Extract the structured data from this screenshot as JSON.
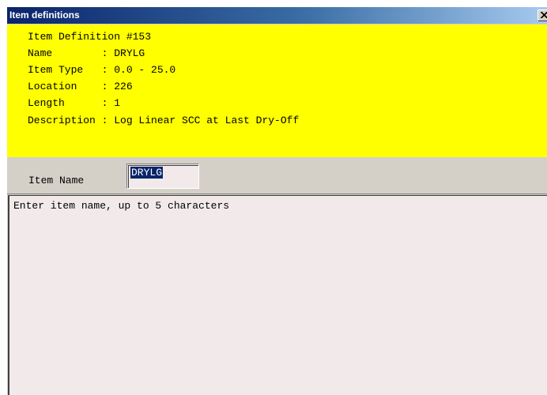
{
  "window": {
    "title": "Item definitions"
  },
  "info": {
    "lines": [
      "Item Definition #153",
      "Name        : DRYLG",
      "Item Type   : 0.0 - 25.0",
      "Location    : 226",
      "Length      : 1",
      "Description : Log Linear SCC at Last Dry-Off"
    ]
  },
  "form": {
    "item_name_label": "Item Name",
    "item_name_value": "DRYLG"
  },
  "help": {
    "text": "Enter item name, up to 5 characters"
  },
  "colors": {
    "info_background": "#ffff00",
    "title_bar": "#0a246a",
    "selection": "#0a246a",
    "input_background": "#f2eaea"
  },
  "icons": {
    "close": "close-icon"
  }
}
